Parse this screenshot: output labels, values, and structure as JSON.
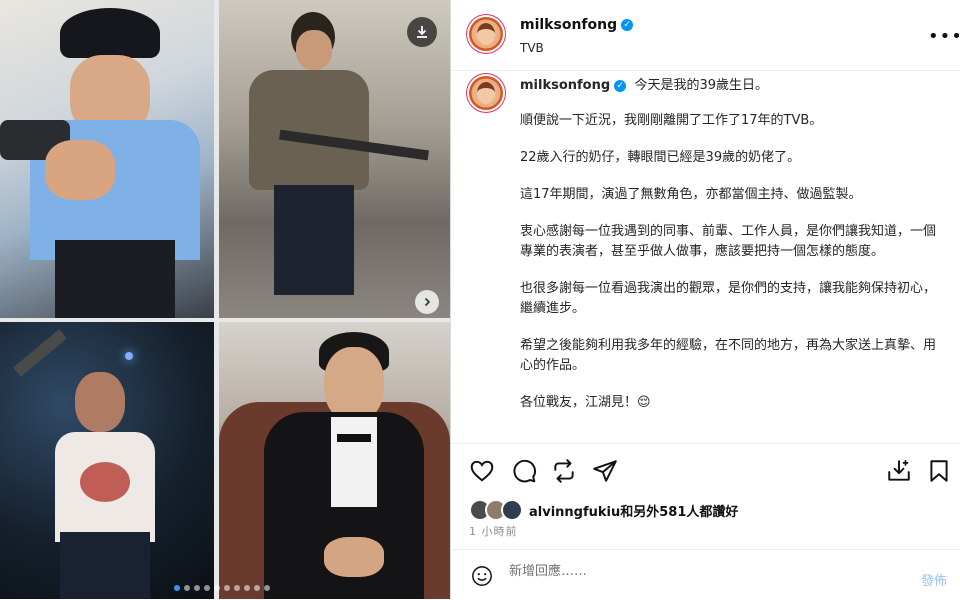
{
  "post": {
    "username": "milksonfong",
    "subtitle": "TVB",
    "more_icon": "more-horizontal-icon",
    "verified_icon": "verified-badge-icon",
    "caption_username": "milksonfong",
    "caption_lines": [
      "今天是我的39歲生日。",
      "順便說一下近況，我剛剛離開了工作了17年的TVB。",
      "22歲入行的奶仔，轉眼間已經是39歲的奶佬了。",
      "這17年期間，演過了無數角色，亦都當個主持、做過監製。",
      "衷心感謝每一位我遇到的同事、前輩、工作人員，是你們讓我知道，一個專業的表演者，甚至乎做人做事，應該要把持一個怎樣的態度。",
      "也很多謝每一位看過我演出的觀眾，是你們的支持，讓我能夠保持初心，繼續進步。",
      "希望之後能夠利用我多年的經驗，在不同的地方，再為大家送上真摯、用心的作品。",
      "各位戰友，江湖見！😌"
    ],
    "likes_text": "alvinngfukiu和另外581人都讚好",
    "time_text": "1 小時前",
    "comment_placeholder": "新增回應……",
    "post_button": "發佈"
  },
  "media": {
    "carousel_count": 10,
    "active_index": 0,
    "download_icon": "download-icon",
    "next_icon": "chevron-right-icon"
  },
  "actions": [
    "heart-icon",
    "comment-icon",
    "repost-icon",
    "share-icon",
    "save-to-collection-icon",
    "bookmark-icon"
  ],
  "colors": {
    "verified": "#0095f6",
    "post_button": "#9cc4f5",
    "active_dot": "#3897f0"
  }
}
